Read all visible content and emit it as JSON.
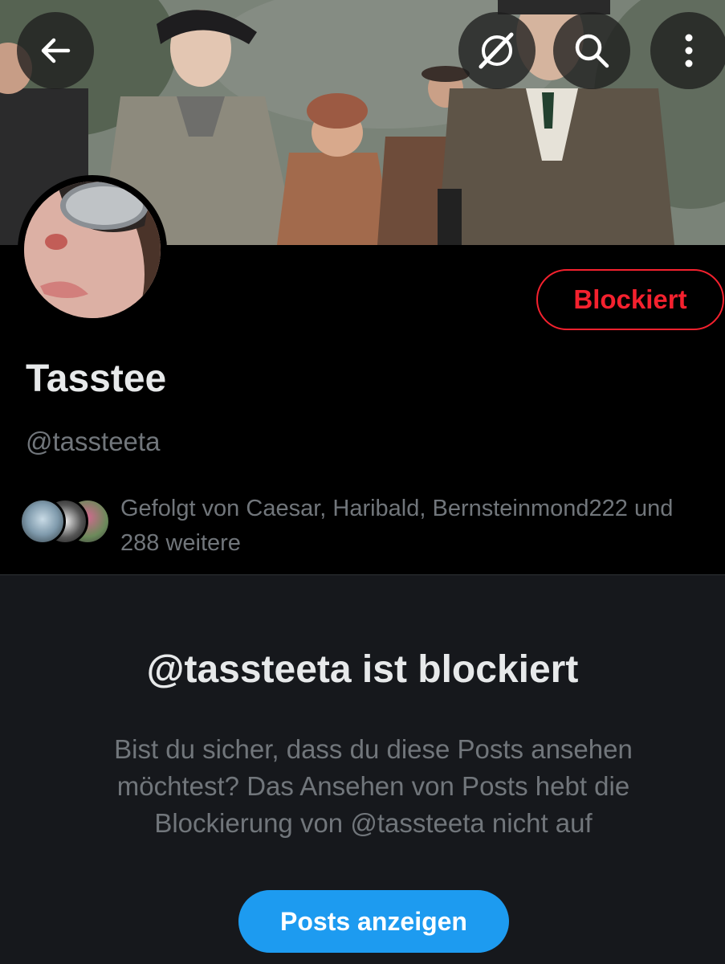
{
  "toolbar": {
    "back_icon": "arrow-left-icon",
    "grok_icon": "grok-icon",
    "search_icon": "search-icon",
    "more_icon": "more-vertical-icon"
  },
  "profile": {
    "display_name": "Tasstee",
    "handle": "@tassteeta",
    "block_button_label": "Blockiert",
    "followed_by": "Gefolgt von Caesar, Haribald, Bernsteinmond222 und 288 weitere"
  },
  "blocked_notice": {
    "title": "@tassteeta ist blockiert",
    "description": "Bist du sicher, dass du diese Posts ansehen möchtest? Das Ansehen von Posts hebt die Blockierung von @tassteeta nicht auf",
    "show_posts_label": "Posts anzeigen"
  },
  "colors": {
    "accent": "#1d9bf0",
    "blocked_red": "#f4212e",
    "muted_text": "#71767b"
  }
}
